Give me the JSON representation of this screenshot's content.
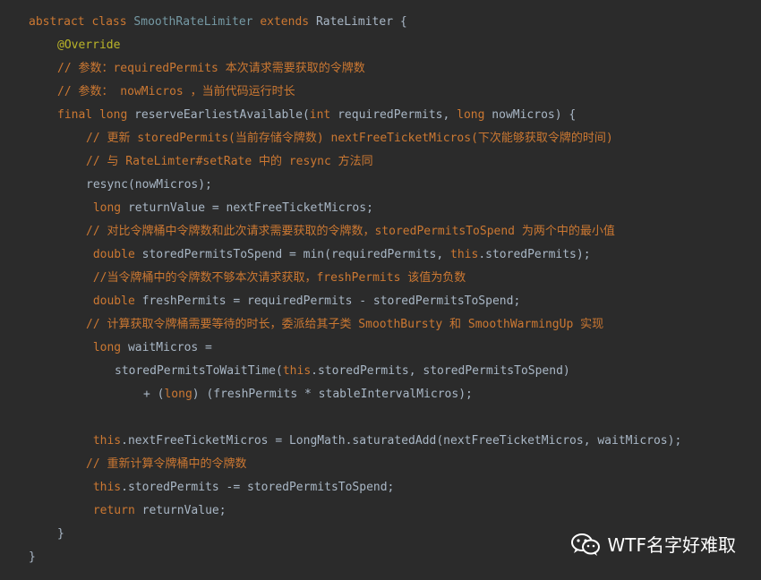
{
  "colors": {
    "background": "#2b2b2b",
    "keyword": "#cc7832",
    "identifier": "#a9b7c6",
    "class_name": "#769aa5",
    "annotation": "#bbb529",
    "comment": "#cc7832",
    "watermark": "#ffffff"
  },
  "code": {
    "lines": [
      {
        "indent": 0,
        "tokens": [
          {
            "t": "kw",
            "v": "abstract "
          },
          {
            "t": "kw",
            "v": "class "
          },
          {
            "t": "cls-decl",
            "v": "SmoothRateLimiter "
          },
          {
            "t": "kw",
            "v": "extends "
          },
          {
            "t": "plain",
            "v": "RateLimiter {"
          }
        ]
      },
      {
        "indent": 1,
        "tokens": [
          {
            "t": "ann",
            "v": "@Override"
          }
        ]
      },
      {
        "indent": 1,
        "tokens": [
          {
            "t": "cmt",
            "v": "// 参数：requiredPermits 本次请求需要获取的令牌数"
          }
        ]
      },
      {
        "indent": 1,
        "tokens": [
          {
            "t": "cmt",
            "v": "// 参数： nowMicros ，当前代码运行时长"
          }
        ]
      },
      {
        "indent": 1,
        "tokens": [
          {
            "t": "kw",
            "v": "final "
          },
          {
            "t": "kw",
            "v": "long "
          },
          {
            "t": "plain",
            "v": "reserveEarliestAvailable("
          },
          {
            "t": "kw",
            "v": "int "
          },
          {
            "t": "plain",
            "v": "requiredPermits, "
          },
          {
            "t": "kw",
            "v": "long "
          },
          {
            "t": "plain",
            "v": "nowMicros) {"
          }
        ]
      },
      {
        "indent": 2,
        "tokens": [
          {
            "t": "cmt",
            "v": "// 更新 storedPermits(当前存储令牌数) nextFreeTicketMicros(下次能够获取令牌的时间)"
          }
        ]
      },
      {
        "indent": 2,
        "tokens": [
          {
            "t": "cmt",
            "v": "// 与 RateLimter#setRate 中的 resync 方法同"
          }
        ]
      },
      {
        "indent": 2,
        "tokens": [
          {
            "t": "plain",
            "v": "resync(nowMicros);"
          }
        ]
      },
      {
        "indent": 2,
        "tokens": [
          {
            "t": "kw",
            "v": " long "
          },
          {
            "t": "plain",
            "v": "returnValue = nextFreeTicketMicros;"
          }
        ]
      },
      {
        "indent": 2,
        "tokens": [
          {
            "t": "cmt",
            "v": "// 对比令牌桶中令牌数和此次请求需要获取的令牌数，storedPermitsToSpend 为两个中的最小值"
          }
        ]
      },
      {
        "indent": 2,
        "tokens": [
          {
            "t": "kw",
            "v": " double "
          },
          {
            "t": "plain",
            "v": "storedPermitsToSpend = min(requiredPermits, "
          },
          {
            "t": "this",
            "v": "this"
          },
          {
            "t": "plain",
            "v": ".storedPermits);"
          }
        ]
      },
      {
        "indent": 2,
        "tokens": [
          {
            "t": "cmt",
            "v": " //当令牌桶中的令牌数不够本次请求获取，freshPermits 该值为负数"
          }
        ]
      },
      {
        "indent": 2,
        "tokens": [
          {
            "t": "kw",
            "v": " double "
          },
          {
            "t": "plain",
            "v": "freshPermits = requiredPermits - storedPermitsToSpend;"
          }
        ]
      },
      {
        "indent": 2,
        "tokens": [
          {
            "t": "cmt",
            "v": "// 计算获取令牌桶需要等待的时长，委派给其子类 SmoothBursty 和 SmoothWarmingUp 实现"
          }
        ]
      },
      {
        "indent": 2,
        "tokens": [
          {
            "t": "kw",
            "v": " long "
          },
          {
            "t": "plain",
            "v": "waitMicros ="
          }
        ]
      },
      {
        "indent": 3,
        "tokens": [
          {
            "t": "plain",
            "v": "storedPermitsToWaitTime("
          },
          {
            "t": "this",
            "v": "this"
          },
          {
            "t": "plain",
            "v": ".storedPermits, storedPermitsToSpend)"
          }
        ]
      },
      {
        "indent": 4,
        "tokens": [
          {
            "t": "plain",
            "v": "+ ("
          },
          {
            "t": "kw",
            "v": "long"
          },
          {
            "t": "plain",
            "v": ") (freshPermits * stableIntervalMicros);"
          }
        ]
      },
      {
        "indent": 0,
        "tokens": []
      },
      {
        "indent": 2,
        "tokens": [
          {
            "t": "this",
            "v": " this"
          },
          {
            "t": "plain",
            "v": ".nextFreeTicketMicros = LongMath.saturatedAdd(nextFreeTicketMicros, waitMicros);"
          }
        ]
      },
      {
        "indent": 2,
        "tokens": [
          {
            "t": "cmt",
            "v": "// 重新计算令牌桶中的令牌数"
          }
        ]
      },
      {
        "indent": 2,
        "tokens": [
          {
            "t": "this",
            "v": " this"
          },
          {
            "t": "plain",
            "v": ".storedPermits -= storedPermitsToSpend;"
          }
        ]
      },
      {
        "indent": 2,
        "tokens": [
          {
            "t": "kw",
            "v": " return "
          },
          {
            "t": "plain",
            "v": "returnValue;"
          }
        ]
      },
      {
        "indent": 1,
        "tokens": [
          {
            "t": "plain",
            "v": "}"
          }
        ]
      },
      {
        "indent": 0,
        "tokens": [
          {
            "t": "plain",
            "v": "}"
          }
        ]
      }
    ]
  },
  "watermark": {
    "icon": "wechat-icon",
    "text": "WTF名字好难取"
  }
}
